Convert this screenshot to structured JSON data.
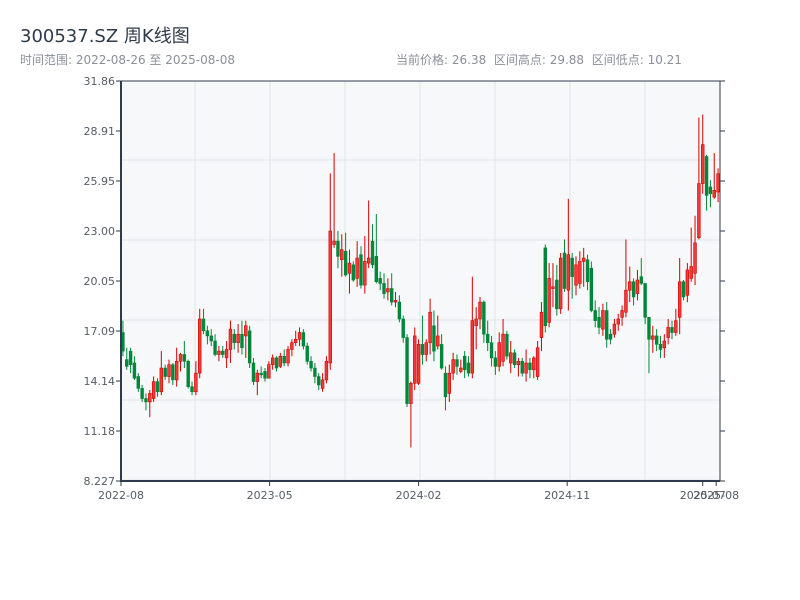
{
  "header": {
    "title": "300537.SZ 周K线图",
    "range_label": "时间范围: 2022-08-26 至 2025-08-08",
    "current_label": "当前价格: 26.38",
    "high_label": "区间高点: 29.88",
    "low_label": "区间低点: 10.21"
  },
  "colors": {
    "up": "#d40000",
    "up_fill": "#f03a3a",
    "down": "#00873a",
    "plot_bg": "#f7f8fa",
    "grid": "#e1e4ea",
    "axis": "#2f3a4a"
  },
  "chart_data": {
    "type": "candlestick",
    "title": "300537.SZ 周K线图",
    "period": "weekly",
    "up_color_meaning": "red = close above open",
    "ylim": [
      8.227,
      31.86
    ],
    "y_ticks": [
      "31.86",
      "28.91",
      "25.95",
      "23.00",
      "20.05",
      "17.09",
      "14.14",
      "11.18",
      "8.227"
    ],
    "x_ticks": [
      {
        "label": "2022-08",
        "index": 0
      },
      {
        "label": "2023-05",
        "index": 38.7
      },
      {
        "label": "2024-02",
        "index": 77.5
      },
      {
        "label": "2024-11",
        "index": 116.2
      },
      {
        "label": "2025-07",
        "index": 151.5
      },
      {
        "label": "2025-08",
        "index": 155
      }
    ],
    "grid": true,
    "fields": [
      "open",
      "high",
      "low",
      "close"
    ],
    "ohlc": [
      [
        17.0,
        17.7,
        15.6,
        15.9
      ],
      [
        15.4,
        16.1,
        14.8,
        15.0
      ],
      [
        15.9,
        16.1,
        14.6,
        15.1
      ],
      [
        15.2,
        15.6,
        14.2,
        14.3
      ],
      [
        14.4,
        14.6,
        13.5,
        13.7
      ],
      [
        13.7,
        13.9,
        12.9,
        13.1
      ],
      [
        13.1,
        13.4,
        12.4,
        12.9
      ],
      [
        12.9,
        13.6,
        12.0,
        13.4
      ],
      [
        13.1,
        14.4,
        12.9,
        14.1
      ],
      [
        14.1,
        14.3,
        13.2,
        13.5
      ],
      [
        13.5,
        15.9,
        13.3,
        14.9
      ],
      [
        14.9,
        15.1,
        14.2,
        14.4
      ],
      [
        14.4,
        15.4,
        14.0,
        15.1
      ],
      [
        15.1,
        15.2,
        13.9,
        14.2
      ],
      [
        14.2,
        16.1,
        13.8,
        15.3
      ],
      [
        15.3,
        15.8,
        14.7,
        15.7
      ],
      [
        15.7,
        16.5,
        14.9,
        15.3
      ],
      [
        15.3,
        15.4,
        13.7,
        13.8
      ],
      [
        13.8,
        14.1,
        13.3,
        13.5
      ],
      [
        13.5,
        15.3,
        13.3,
        14.6
      ],
      [
        14.6,
        18.4,
        14.3,
        17.8
      ],
      [
        17.8,
        18.4,
        16.9,
        17.1
      ],
      [
        17.1,
        17.4,
        16.3,
        16.8
      ],
      [
        16.8,
        17.2,
        16.2,
        16.5
      ],
      [
        16.5,
        16.9,
        15.6,
        15.7
      ],
      [
        15.7,
        16.2,
        15.3,
        15.9
      ],
      [
        15.9,
        16.2,
        15.5,
        15.7
      ],
      [
        15.5,
        16.5,
        14.9,
        16.0
      ],
      [
        16.0,
        17.7,
        15.2,
        17.2
      ],
      [
        16.9,
        17.2,
        16.0,
        16.4
      ],
      [
        16.4,
        17.5,
        15.8,
        16.9
      ],
      [
        16.9,
        17.7,
        15.7,
        16.1
      ],
      [
        16.8,
        17.7,
        15.5,
        17.4
      ],
      [
        17.1,
        17.4,
        14.9,
        15.2
      ],
      [
        15.2,
        15.5,
        13.9,
        14.1
      ],
      [
        14.1,
        14.8,
        13.3,
        14.6
      ],
      [
        14.6,
        15.0,
        14.3,
        14.5
      ],
      [
        14.7,
        14.9,
        14.1,
        14.3
      ],
      [
        14.3,
        15.3,
        14.3,
        15.1
      ],
      [
        15.1,
        15.7,
        14.8,
        15.5
      ],
      [
        15.5,
        15.6,
        14.7,
        14.9
      ],
      [
        15.0,
        15.8,
        14.9,
        15.6
      ],
      [
        15.6,
        16.0,
        15.0,
        15.2
      ],
      [
        15.2,
        16.2,
        15.0,
        16.0
      ],
      [
        16.0,
        16.6,
        15.6,
        16.4
      ],
      [
        16.4,
        17.1,
        16.2,
        16.6
      ],
      [
        16.6,
        17.3,
        16.2,
        17.0
      ],
      [
        17.0,
        17.2,
        16.0,
        16.2
      ],
      [
        16.2,
        16.4,
        15.1,
        15.3
      ],
      [
        15.3,
        15.6,
        14.7,
        14.9
      ],
      [
        14.9,
        15.2,
        14.0,
        14.4
      ],
      [
        14.4,
        14.6,
        13.6,
        13.9
      ],
      [
        13.7,
        14.6,
        13.5,
        14.2
      ],
      [
        14.2,
        15.6,
        14.0,
        15.3
      ],
      [
        15.2,
        26.4,
        14.8,
        23.0
      ],
      [
        22.2,
        27.6,
        22.0,
        22.4
      ],
      [
        22.4,
        23.0,
        20.8,
        21.5
      ],
      [
        21.3,
        22.8,
        20.3,
        21.9
      ],
      [
        21.8,
        22.9,
        20.3,
        20.4
      ],
      [
        20.5,
        21.9,
        19.3,
        21.1
      ],
      [
        21.0,
        21.2,
        20.0,
        20.1
      ],
      [
        20.2,
        22.4,
        19.7,
        21.4
      ],
      [
        21.6,
        22.1,
        19.6,
        19.8
      ],
      [
        19.8,
        22.7,
        19.3,
        21.2
      ],
      [
        21.1,
        24.8,
        20.8,
        21.4
      ],
      [
        22.4,
        23.4,
        20.8,
        21.0
      ],
      [
        21.5,
        24.0,
        19.9,
        20.0
      ],
      [
        20.2,
        20.6,
        19.5,
        19.9
      ],
      [
        19.9,
        20.5,
        19.0,
        19.3
      ],
      [
        19.4,
        20.2,
        18.9,
        19.6
      ],
      [
        19.6,
        20.5,
        18.6,
        18.8
      ],
      [
        18.8,
        19.4,
        18.5,
        18.9
      ],
      [
        18.8,
        19.2,
        17.6,
        17.8
      ],
      [
        17.8,
        18.0,
        16.4,
        16.7
      ],
      [
        16.7,
        16.9,
        12.6,
        12.8
      ],
      [
        12.8,
        14.1,
        10.21,
        14.0
      ],
      [
        14.0,
        17.3,
        13.6,
        16.8
      ],
      [
        14.0,
        16.6,
        13.9,
        16.3
      ],
      [
        16.3,
        18.0,
        15.1,
        15.7
      ],
      [
        15.7,
        16.6,
        15.3,
        16.4
      ],
      [
        16.4,
        19.0,
        15.7,
        18.2
      ],
      [
        17.4,
        18.3,
        15.3,
        15.9
      ],
      [
        16.2,
        18.0,
        16.0,
        16.8
      ],
      [
        16.3,
        16.9,
        14.8,
        14.9
      ],
      [
        14.6,
        15.0,
        12.4,
        13.2
      ],
      [
        13.4,
        15.1,
        12.9,
        14.6
      ],
      [
        14.6,
        15.8,
        14.2,
        15.4
      ],
      [
        15.4,
        15.7,
        14.5,
        15.0
      ],
      [
        14.7,
        15.4,
        14.6,
        14.9
      ],
      [
        15.6,
        15.9,
        14.3,
        14.8
      ],
      [
        15.2,
        15.6,
        14.4,
        14.6
      ],
      [
        14.6,
        20.3,
        14.3,
        17.7
      ],
      [
        17.4,
        18.5,
        16.0,
        17.8
      ],
      [
        17.8,
        19.1,
        17.2,
        18.8
      ],
      [
        18.8,
        18.9,
        16.4,
        16.9
      ],
      [
        16.9,
        17.7,
        15.9,
        16.4
      ],
      [
        16.4,
        16.8,
        15.0,
        15.5
      ],
      [
        15.5,
        15.9,
        14.5,
        15.0
      ],
      [
        15.0,
        17.0,
        14.7,
        16.4
      ],
      [
        15.3,
        17.8,
        15.0,
        16.9
      ],
      [
        16.9,
        17.1,
        15.4,
        15.6
      ],
      [
        15.2,
        16.5,
        14.6,
        15.8
      ],
      [
        15.8,
        16.0,
        14.9,
        15.1
      ],
      [
        15.1,
        15.5,
        14.4,
        15.3
      ],
      [
        15.3,
        15.5,
        14.4,
        14.6
      ],
      [
        14.6,
        16.0,
        14.1,
        15.2
      ],
      [
        15.2,
        15.5,
        14.3,
        14.8
      ],
      [
        14.8,
        15.6,
        14.3,
        15.5
      ],
      [
        14.4,
        16.5,
        14.2,
        16.1
      ],
      [
        16.7,
        18.8,
        15.9,
        18.2
      ],
      [
        22.0,
        22.2,
        17.0,
        17.4
      ],
      [
        17.6,
        21.1,
        17.3,
        20.2
      ],
      [
        19.6,
        21.1,
        18.5,
        19.7
      ],
      [
        20.1,
        21.0,
        18.0,
        18.4
      ],
      [
        18.4,
        21.7,
        18.1,
        21.4
      ],
      [
        21.7,
        22.5,
        19.4,
        19.6
      ],
      [
        19.5,
        24.9,
        18.3,
        21.6
      ],
      [
        21.4,
        21.7,
        19.0,
        20.3
      ],
      [
        19.8,
        21.5,
        19.2,
        21.0
      ],
      [
        19.9,
        21.8,
        19.6,
        21.2
      ],
      [
        21.2,
        22.0,
        19.7,
        21.4
      ],
      [
        21.3,
        21.6,
        19.5,
        20.0
      ],
      [
        20.8,
        21.2,
        18.2,
        18.3
      ],
      [
        18.3,
        18.9,
        17.3,
        17.7
      ],
      [
        17.9,
        18.5,
        16.9,
        17.3
      ],
      [
        17.2,
        18.7,
        16.8,
        18.3
      ],
      [
        18.3,
        18.8,
        16.1,
        16.6
      ],
      [
        16.9,
        17.2,
        16.3,
        16.6
      ],
      [
        16.9,
        17.8,
        16.7,
        17.5
      ],
      [
        17.5,
        18.1,
        17.1,
        17.8
      ],
      [
        17.9,
        18.6,
        17.4,
        18.3
      ],
      [
        18.2,
        22.5,
        17.9,
        19.5
      ],
      [
        19.5,
        20.9,
        18.8,
        20.0
      ],
      [
        20.0,
        20.2,
        18.6,
        19.1
      ],
      [
        19.3,
        20.7,
        18.9,
        20.1
      ],
      [
        20.3,
        21.4,
        19.8,
        19.9
      ],
      [
        19.9,
        19.9,
        17.5,
        17.9
      ],
      [
        17.9,
        17.9,
        14.6,
        16.6
      ],
      [
        16.6,
        17.4,
        15.8,
        16.8
      ],
      [
        16.8,
        17.2,
        15.9,
        16.3
      ],
      [
        16.3,
        16.8,
        15.5,
        16.0
      ],
      [
        16.1,
        16.9,
        15.5,
        16.5
      ],
      [
        16.7,
        17.8,
        16.3,
        17.3
      ],
      [
        17.3,
        17.7,
        16.6,
        17.0
      ],
      [
        17.0,
        18.4,
        16.8,
        17.7
      ],
      [
        17.9,
        21.4,
        16.9,
        20.0
      ],
      [
        20.0,
        20.1,
        18.9,
        19.1
      ],
      [
        19.2,
        21.1,
        18.8,
        20.7
      ],
      [
        20.2,
        23.2,
        20.0,
        20.9
      ],
      [
        20.5,
        23.9,
        19.8,
        22.3
      ],
      [
        22.6,
        29.7,
        22.5,
        25.8
      ],
      [
        25.8,
        29.88,
        25.2,
        28.1
      ],
      [
        27.4,
        27.5,
        24.2,
        25.1
      ],
      [
        25.6,
        26.0,
        24.4,
        25.2
      ],
      [
        25.0,
        27.6,
        24.9,
        25.4
      ],
      [
        25.3,
        26.7,
        24.7,
        26.38
      ]
    ]
  }
}
